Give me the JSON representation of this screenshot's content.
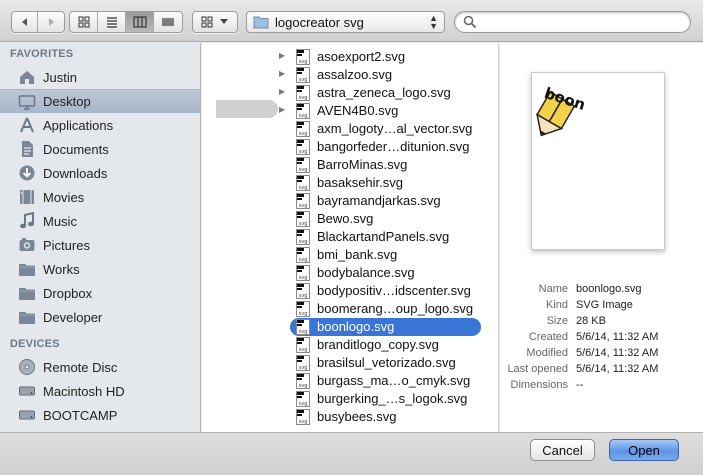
{
  "toolbar": {
    "path_label": "logocreator svg",
    "search_placeholder": ""
  },
  "sidebar": {
    "favorites_label": "FAVORITES",
    "favorites": [
      {
        "label": "Justin",
        "icon": "home-icon"
      },
      {
        "label": "Desktop",
        "icon": "desktop-icon",
        "selected": true
      },
      {
        "label": "Applications",
        "icon": "applications-icon"
      },
      {
        "label": "Documents",
        "icon": "documents-icon"
      },
      {
        "label": "Downloads",
        "icon": "downloads-icon"
      },
      {
        "label": "Movies",
        "icon": "movies-icon"
      },
      {
        "label": "Music",
        "icon": "music-icon"
      },
      {
        "label": "Pictures",
        "icon": "pictures-icon"
      },
      {
        "label": "Works",
        "icon": "folder-icon"
      },
      {
        "label": "Dropbox",
        "icon": "folder-icon"
      },
      {
        "label": "Developer",
        "icon": "folder-icon"
      }
    ],
    "devices_label": "DEVICES",
    "devices": [
      {
        "label": "Remote Disc",
        "icon": "disc-icon"
      },
      {
        "label": "Macintosh HD",
        "icon": "hard-drive-icon"
      },
      {
        "label": "BOOTCAMP",
        "icon": "hard-drive-icon"
      }
    ]
  },
  "files": [
    {
      "name": "asoexport2.svg"
    },
    {
      "name": "assalzoo.svg"
    },
    {
      "name": "astra_zeneca_logo.svg"
    },
    {
      "name": "AVEN4B0.svg"
    },
    {
      "name": "axm_logoty…al_vector.svg"
    },
    {
      "name": "bangorfeder…ditunion.svg"
    },
    {
      "name": "BarroMinas.svg"
    },
    {
      "name": "basaksehir.svg"
    },
    {
      "name": "bayramandjarkas.svg"
    },
    {
      "name": "Bewo.svg"
    },
    {
      "name": "BlackartandPanels.svg"
    },
    {
      "name": "bmi_bank.svg"
    },
    {
      "name": "bodybalance.svg"
    },
    {
      "name": "bodypositiv…idscenter.svg"
    },
    {
      "name": "boomerang…oup_logo.svg"
    },
    {
      "name": "boonlogo.svg",
      "selected": true
    },
    {
      "name": "branditlogo_copy.svg"
    },
    {
      "name": "brasilsul_vetorizado.svg"
    },
    {
      "name": "burgass_ma…o_cmyk.svg"
    },
    {
      "name": "burgerking_…s_logok.svg"
    },
    {
      "name": "busybees.svg"
    }
  ],
  "file_icon_text": "svg",
  "preview": {
    "logo_text": "boon",
    "info": [
      {
        "key": "Name",
        "value": "boonlogo.svg"
      },
      {
        "key": "Kind",
        "value": "SVG Image"
      },
      {
        "key": "Size",
        "value": "28 KB"
      },
      {
        "key": "Created",
        "value": "5/6/14, 11:32 AM"
      },
      {
        "key": "Modified",
        "value": "5/6/14, 11:32 AM"
      },
      {
        "key": "Last opened",
        "value": "5/6/14, 11:32 AM"
      },
      {
        "key": "Dimensions",
        "value": "--"
      }
    ]
  },
  "buttons": {
    "cancel": "Cancel",
    "open": "Open"
  },
  "colors": {
    "selection": "#3875d7",
    "sidebar_bg": "#e4e8ed",
    "sidebar_selected": "#aebccd"
  }
}
